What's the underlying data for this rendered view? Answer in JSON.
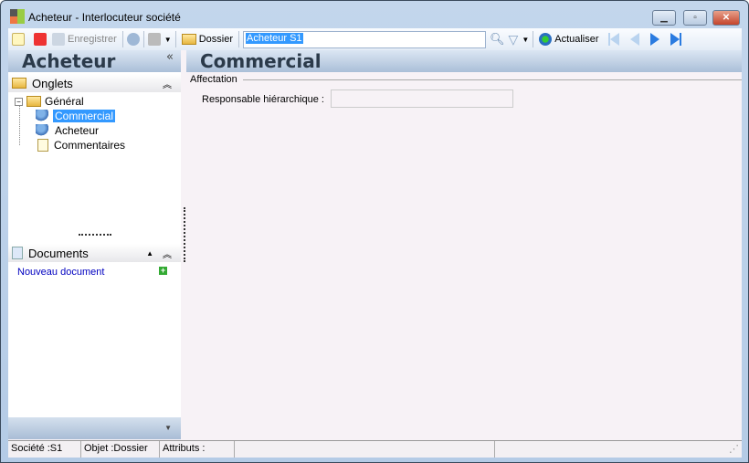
{
  "window": {
    "title": "Acheteur -  Interlocuteur société",
    "minimize": "minimize",
    "maximize": "maximize",
    "close": "close"
  },
  "toolbar": {
    "save_label": "Enregistrer",
    "folder_label": "Dossier",
    "search_value": "Acheteur S1",
    "refresh_label": "Actualiser"
  },
  "left": {
    "title": "Acheteur",
    "tabs_section": "Onglets",
    "tree": {
      "root": "Général",
      "children": [
        "Commercial",
        "Acheteur",
        "Commentaires"
      ],
      "selected": "Commercial"
    },
    "documents_section": "Documents",
    "new_document": "Nouveau document"
  },
  "main": {
    "title": "Commercial",
    "group": "Affectation",
    "field_label": "Responsable hiérarchique :",
    "field_value": ""
  },
  "status": {
    "company": "Société :S1",
    "object": "Objet :Dossier",
    "attributes": "Attributs :"
  },
  "colors": {
    "selection": "#3399ff",
    "link": "#0000c0"
  }
}
